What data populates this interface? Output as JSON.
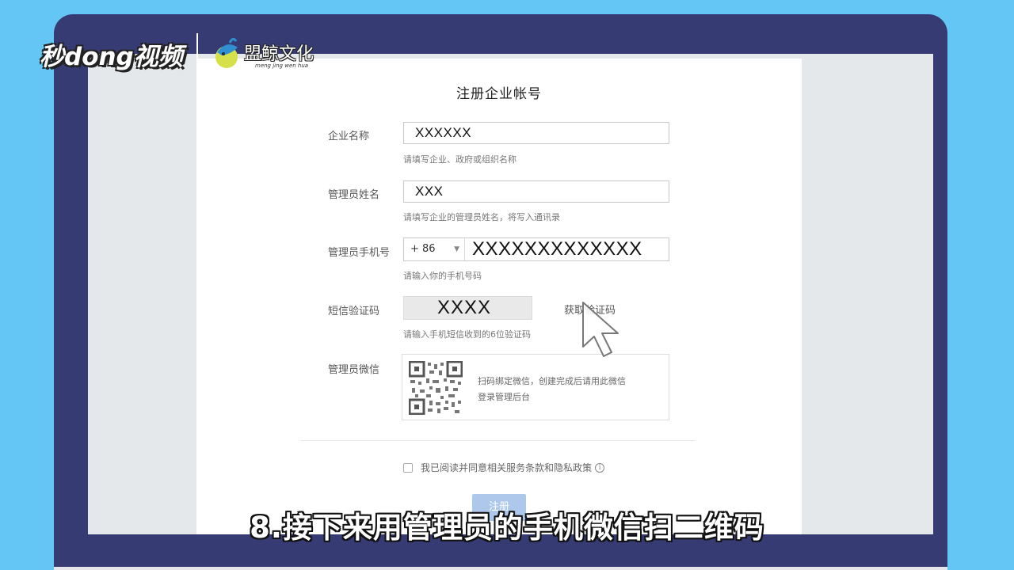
{
  "watermark": {
    "left_logo": "秒dong视频",
    "right_logo_cn": "盟鲸文化",
    "right_logo_pinyin": "meng jing wen hua"
  },
  "form": {
    "title": "注册企业帐号",
    "company": {
      "label": "企业名称",
      "value": "XXXXXX",
      "hint": "请填写企业、政府或组织名称"
    },
    "admin_name": {
      "label": "管理员姓名",
      "value": "XXX",
      "hint": "请填写企业的管理员姓名，将写入通讯录"
    },
    "admin_phone": {
      "label": "管理员手机号",
      "country_code": "+ 86",
      "value": "XXXXXXXXXXXXX",
      "hint": "请输入你的手机号码"
    },
    "sms_code": {
      "label": "短信验证码",
      "value": "XXXX",
      "get_code": "获取验证码",
      "hint": "请输入手机短信收到的6位验证码"
    },
    "admin_wechat": {
      "label": "管理员微信",
      "text_line1": "扫码绑定微信，创建完成后请用此微信",
      "text_line2": "登录管理后台"
    },
    "agreement": "我已阅读并同意相关服务条款和隐私政策",
    "submit": "注册"
  },
  "subtitle": "8.接下来用管理员的手机微信扫二维码"
}
